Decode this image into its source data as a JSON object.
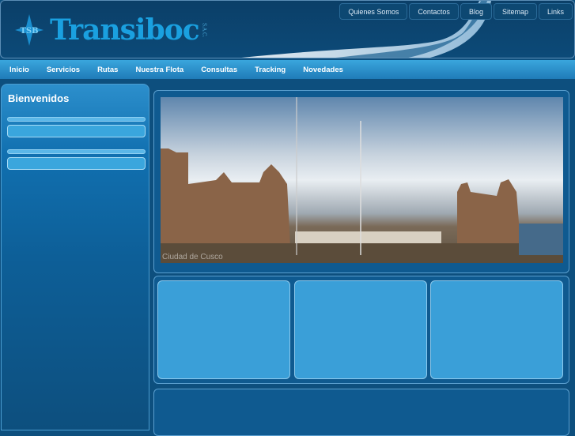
{
  "header": {
    "logo_text": "Transiboc",
    "logo_suffix": "S.A.C.",
    "emblem_text": "TSB",
    "top_links": [
      "Quienes Somos",
      "Contactos",
      "Blog",
      "Sitemap",
      "Links"
    ]
  },
  "nav": {
    "items": [
      "Inicio",
      "Servicios",
      "Rutas",
      "Nuestra Flota",
      "Consultas",
      "Tracking",
      "Novedades"
    ]
  },
  "sidebar": {
    "title": "Bienvenidos"
  },
  "slider": {
    "caption": "Ciudad de Cusco"
  }
}
